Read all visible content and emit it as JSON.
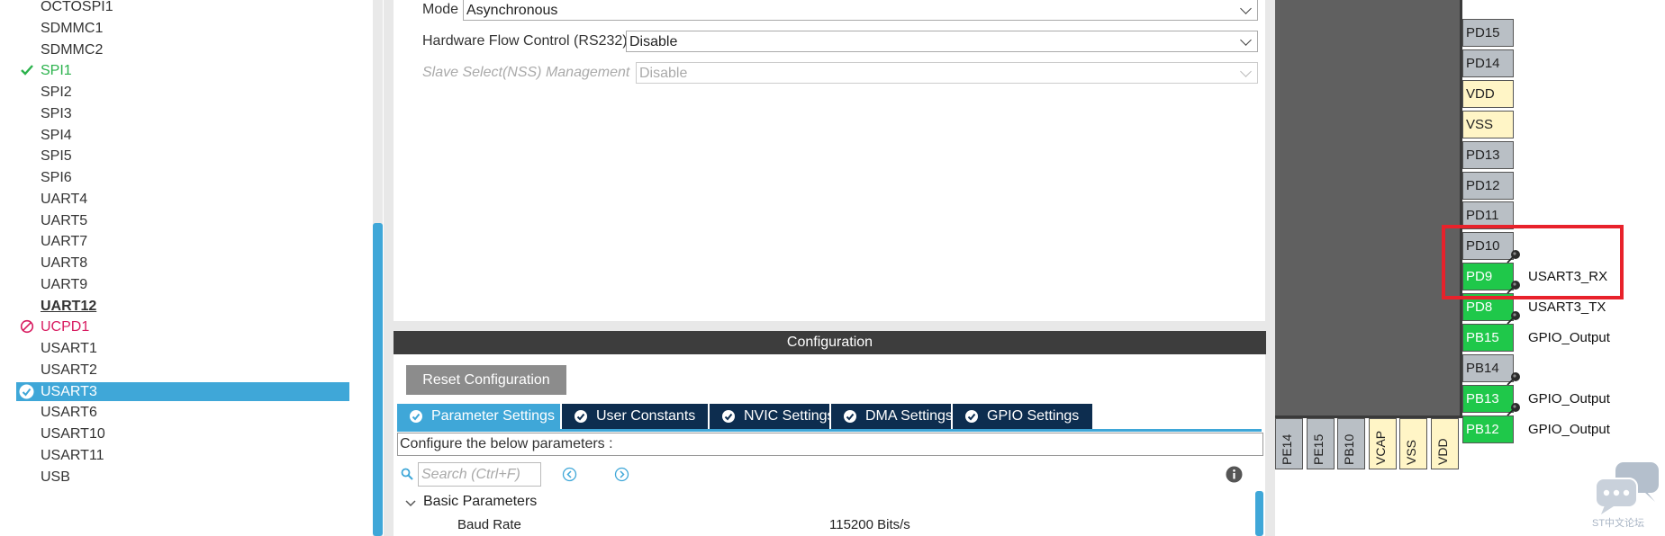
{
  "peripherals": [
    {
      "label": "OCTOSPI1",
      "state": "none"
    },
    {
      "label": "SDMMC1",
      "state": "none"
    },
    {
      "label": "SDMMC2",
      "state": "none"
    },
    {
      "label": "SPI1",
      "state": "ok"
    },
    {
      "label": "SPI2",
      "state": "none"
    },
    {
      "label": "SPI3",
      "state": "none"
    },
    {
      "label": "SPI4",
      "state": "none"
    },
    {
      "label": "SPI5",
      "state": "none"
    },
    {
      "label": "SPI6",
      "state": "none"
    },
    {
      "label": "UART4",
      "state": "none"
    },
    {
      "label": "UART5",
      "state": "none"
    },
    {
      "label": "UART7",
      "state": "none"
    },
    {
      "label": "UART8",
      "state": "none"
    },
    {
      "label": "UART9",
      "state": "none"
    },
    {
      "label": "UART12",
      "state": "bold"
    },
    {
      "label": "UCPD1",
      "state": "blocked"
    },
    {
      "label": "USART1",
      "state": "none"
    },
    {
      "label": "USART2",
      "state": "none"
    },
    {
      "label": "USART3",
      "state": "selected"
    },
    {
      "label": "USART6",
      "state": "none"
    },
    {
      "label": "USART10",
      "state": "none"
    },
    {
      "label": "USART11",
      "state": "none"
    },
    {
      "label": "USB",
      "state": "none"
    }
  ],
  "mode_form": {
    "mode_label": "Mode",
    "mode_value": "Asynchronous",
    "flow_label": "Hardware Flow Control (RS232)",
    "flow_value": "Disable",
    "nss_label": "Slave Select(NSS) Management",
    "nss_value": "Disable"
  },
  "configuration": {
    "header": "Configuration",
    "reset_button": "Reset Configuration",
    "tabs": [
      {
        "label": "Parameter Settings",
        "active": true
      },
      {
        "label": "User Constants",
        "active": false
      },
      {
        "label": "NVIC Settings",
        "active": false
      },
      {
        "label": "DMA Settings",
        "active": false
      },
      {
        "label": "GPIO Settings",
        "active": false
      }
    ],
    "caption": "Configure the below parameters :",
    "search_placeholder": "Search (Ctrl+F)",
    "group": "Basic Parameters",
    "params": [
      {
        "name": "Baud Rate",
        "value": "115200 Bits/s"
      }
    ]
  },
  "chip": {
    "right_pins": [
      {
        "name": "PD15",
        "kind": "gray",
        "signal": ""
      },
      {
        "name": "PD14",
        "kind": "gray",
        "signal": ""
      },
      {
        "name": "VDD",
        "kind": "power",
        "signal": ""
      },
      {
        "name": "VSS",
        "kind": "power",
        "signal": ""
      },
      {
        "name": "PD13",
        "kind": "gray",
        "signal": ""
      },
      {
        "name": "PD12",
        "kind": "gray",
        "signal": ""
      },
      {
        "name": "PD11",
        "kind": "gray",
        "signal": ""
      },
      {
        "name": "PD10",
        "kind": "gray",
        "signal": ""
      },
      {
        "name": "PD9",
        "kind": "green",
        "signal": "USART3_RX"
      },
      {
        "name": "PD8",
        "kind": "green",
        "signal": "USART3_TX"
      },
      {
        "name": "PB15",
        "kind": "green",
        "signal": "GPIO_Output"
      },
      {
        "name": "PB14",
        "kind": "gray",
        "signal": ""
      },
      {
        "name": "PB13",
        "kind": "green",
        "signal": "GPIO_Output"
      },
      {
        "name": "PB12",
        "kind": "green",
        "signal": "GPIO_Output"
      }
    ],
    "bottom_pins": [
      {
        "name": "PE14",
        "kind": "gray"
      },
      {
        "name": "PE15",
        "kind": "gray"
      },
      {
        "name": "PB10",
        "kind": "gray"
      },
      {
        "name": "VCAP",
        "kind": "power"
      },
      {
        "name": "VSS",
        "kind": "power"
      },
      {
        "name": "VDD",
        "kind": "power"
      }
    ]
  },
  "watermark": "ST中文论坛",
  "colors": {
    "accent": "#3fa7d8",
    "pin_green": "#1fc84a",
    "tab_dark": "#0d2d4f",
    "highlight": "#e8222b"
  }
}
